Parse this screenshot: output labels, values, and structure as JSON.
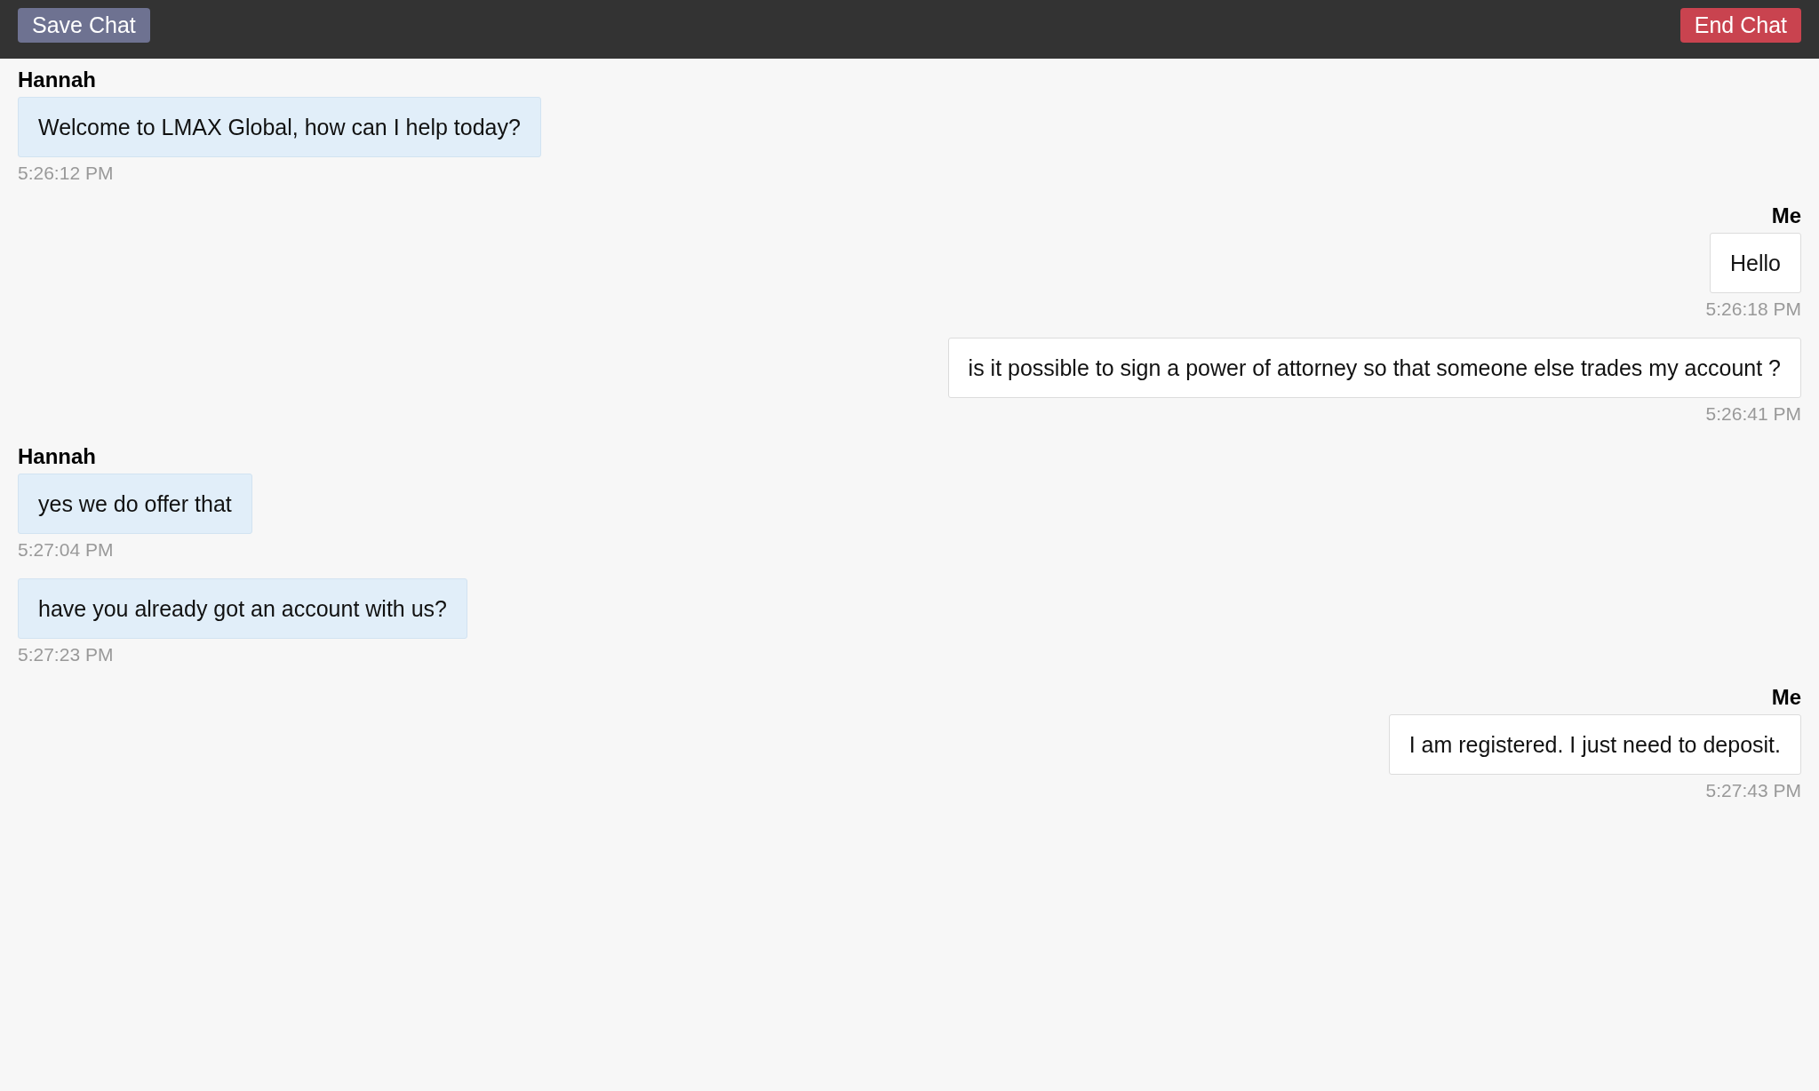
{
  "toolbar": {
    "save_button": "Save Chat",
    "end_button": "End Chat"
  },
  "messages": [
    {
      "kind": "agent",
      "sender": "Hannah",
      "text": "Welcome to LMAX Global, how can I help today?",
      "time": "5:26:12 PM"
    },
    {
      "kind": "user",
      "sender": "Me",
      "text": "Hello",
      "time": "5:26:18 PM"
    },
    {
      "kind": "user",
      "text": "is it possible to sign a power of attorney so that someone else trades my account ?",
      "time": "5:26:41 PM"
    },
    {
      "kind": "agent",
      "sender": "Hannah",
      "text": "yes we do offer that",
      "time": "5:27:04 PM"
    },
    {
      "kind": "agent",
      "text": "have you already got an account with us?",
      "time": "5:27:23 PM"
    },
    {
      "kind": "user",
      "sender": "Me",
      "text": "I am registered. I just need to deposit.",
      "time": "5:27:43 PM"
    }
  ]
}
